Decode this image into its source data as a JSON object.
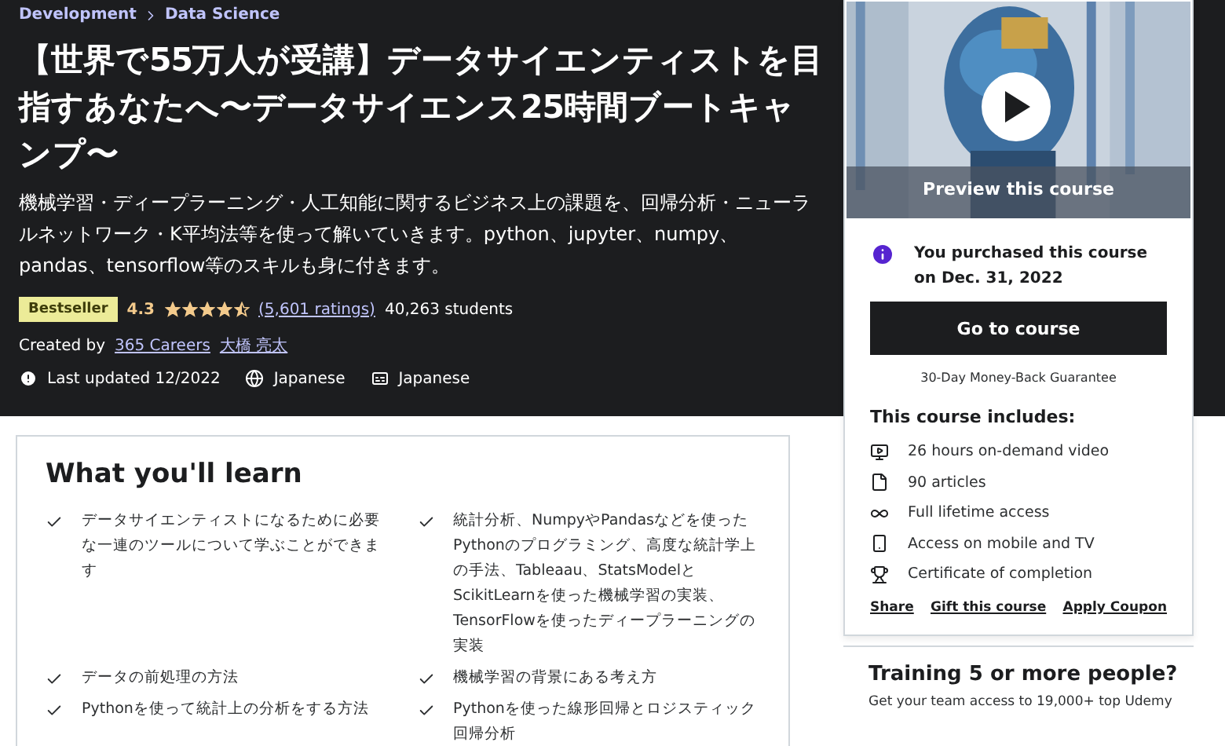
{
  "breadcrumb": [
    "Development",
    "Data Science"
  ],
  "title": "【世界で55万人が受講】データサイエンティストを目指すあなたへ〜データサイエンス25時間ブートキャンプ〜",
  "description": "機械学習・ディープラーニング・人工知能に関するビジネス上の課題を、回帰分析・ニューラルネットワーク・K平均法等を使って解いていきます。python、jupyter、numpy、pandas、tensorflow等のスキルも身に付きます。",
  "badge": "Bestseller",
  "rating": "4.3",
  "stars": 4.5,
  "ratings_link": "(5,601 ratings)",
  "students": "40,263 students",
  "created_by": {
    "label": "Created by",
    "authors": [
      "365 Careers",
      "大橋 亮太"
    ]
  },
  "meta": [
    {
      "kind": "updated",
      "text": "Last updated 12/2022"
    },
    {
      "kind": "language",
      "text": "Japanese"
    },
    {
      "kind": "captions",
      "text": "Japanese"
    }
  ],
  "preview": {
    "label": "Preview this course"
  },
  "purchase_notice": "You purchased this course on Dec. 31, 2022",
  "go_button": "Go to course",
  "guarantee": "30-Day Money-Back Guarantee",
  "includes": {
    "title": "This course includes:",
    "items": [
      {
        "kind": "video",
        "text": "26 hours on-demand video"
      },
      {
        "kind": "article",
        "text": "90 articles"
      },
      {
        "kind": "lifetime",
        "text": "Full lifetime access"
      },
      {
        "kind": "mobile",
        "text": "Access on mobile and TV"
      },
      {
        "kind": "certificate",
        "text": "Certificate of completion"
      }
    ]
  },
  "links": [
    "Share",
    "Gift this course",
    "Apply Coupon"
  ],
  "training": {
    "title": "Training 5 or more people?",
    "text": "Get your team access to 19,000+ top Udemy"
  },
  "learn": {
    "title": "What you'll learn",
    "items": [
      "データサイエンティストになるために必要な一連のツールについて学ぶことができます",
      "統計分析、NumpyやPandasなどを使ったPythonのプログラミング、高度な統計学上の手法、Tableaau、StatsModelとScikitLearnを使った機械学習の実装、TensorFlowを使ったディープラーニングの実装",
      "データの前処理の方法",
      "機械学習の背景にある考え方",
      "Pythonを使って統計上の分析をする方法",
      "Pythonを使った線形回帰とロジスティック回帰分析"
    ]
  }
}
